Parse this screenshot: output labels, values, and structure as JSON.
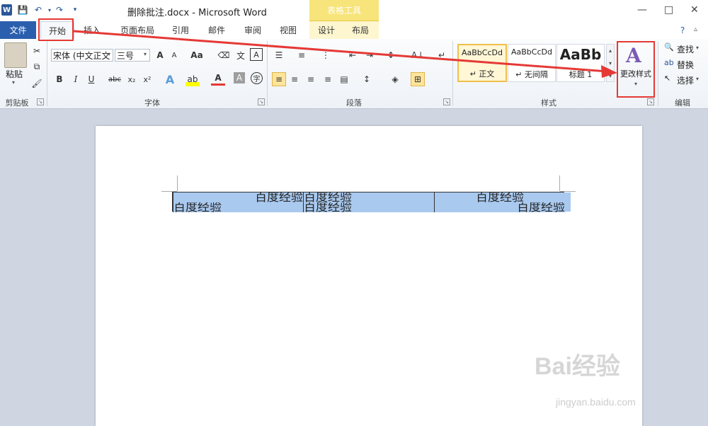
{
  "window": {
    "title": "删除批注.docx - Microsoft Word",
    "contextual_header": "表格工具",
    "word_logo": "W",
    "min_glyph": "—",
    "restore_glyph": "□",
    "close_glyph": "✕"
  },
  "tabs": {
    "file": "文件",
    "home": "开始",
    "insert": "插入",
    "layout": "页面布局",
    "references": "引用",
    "mailings": "邮件",
    "review": "审阅",
    "view": "视图",
    "design": "设计",
    "table_layout": "布局"
  },
  "clipboard": {
    "paste": "粘贴",
    "group": "剪贴板"
  },
  "font": {
    "name": "宋体 (中文正文",
    "size": "三号",
    "grow": "A",
    "shrink": "A",
    "case": "Aa",
    "bold": "B",
    "italic": "I",
    "underline": "U",
    "strike": "abc",
    "subscript": "x₂",
    "superscript": "x²",
    "color_a": "A",
    "group": "字体"
  },
  "paragraph": {
    "group": "段落"
  },
  "styles": {
    "normal_preview": "AaBbCcDd",
    "normal_name": "↵ 正文",
    "nospacing_preview": "AaBbCcDd",
    "nospacing_name": "↵ 无间隔",
    "heading_preview": "AaBb",
    "heading_name": "标题 1",
    "change_styles": "更改样式",
    "group": "样式"
  },
  "editing": {
    "find": "查找",
    "replace": "替换",
    "select": "选择",
    "group": "编辑"
  },
  "table": {
    "rows": [
      [
        "百度经验",
        "百度经验",
        "百度经验"
      ],
      [
        "百度经验",
        "百度经验",
        "百度经验"
      ]
    ]
  },
  "watermark": {
    "brand": "Bai经验",
    "url": "jingyan.baidu.com"
  },
  "colors": {
    "file_tab": "#2b5fae",
    "highlight_red": "#e53935",
    "selection": "#a9c9ef",
    "contextual": "#f7e47a"
  }
}
